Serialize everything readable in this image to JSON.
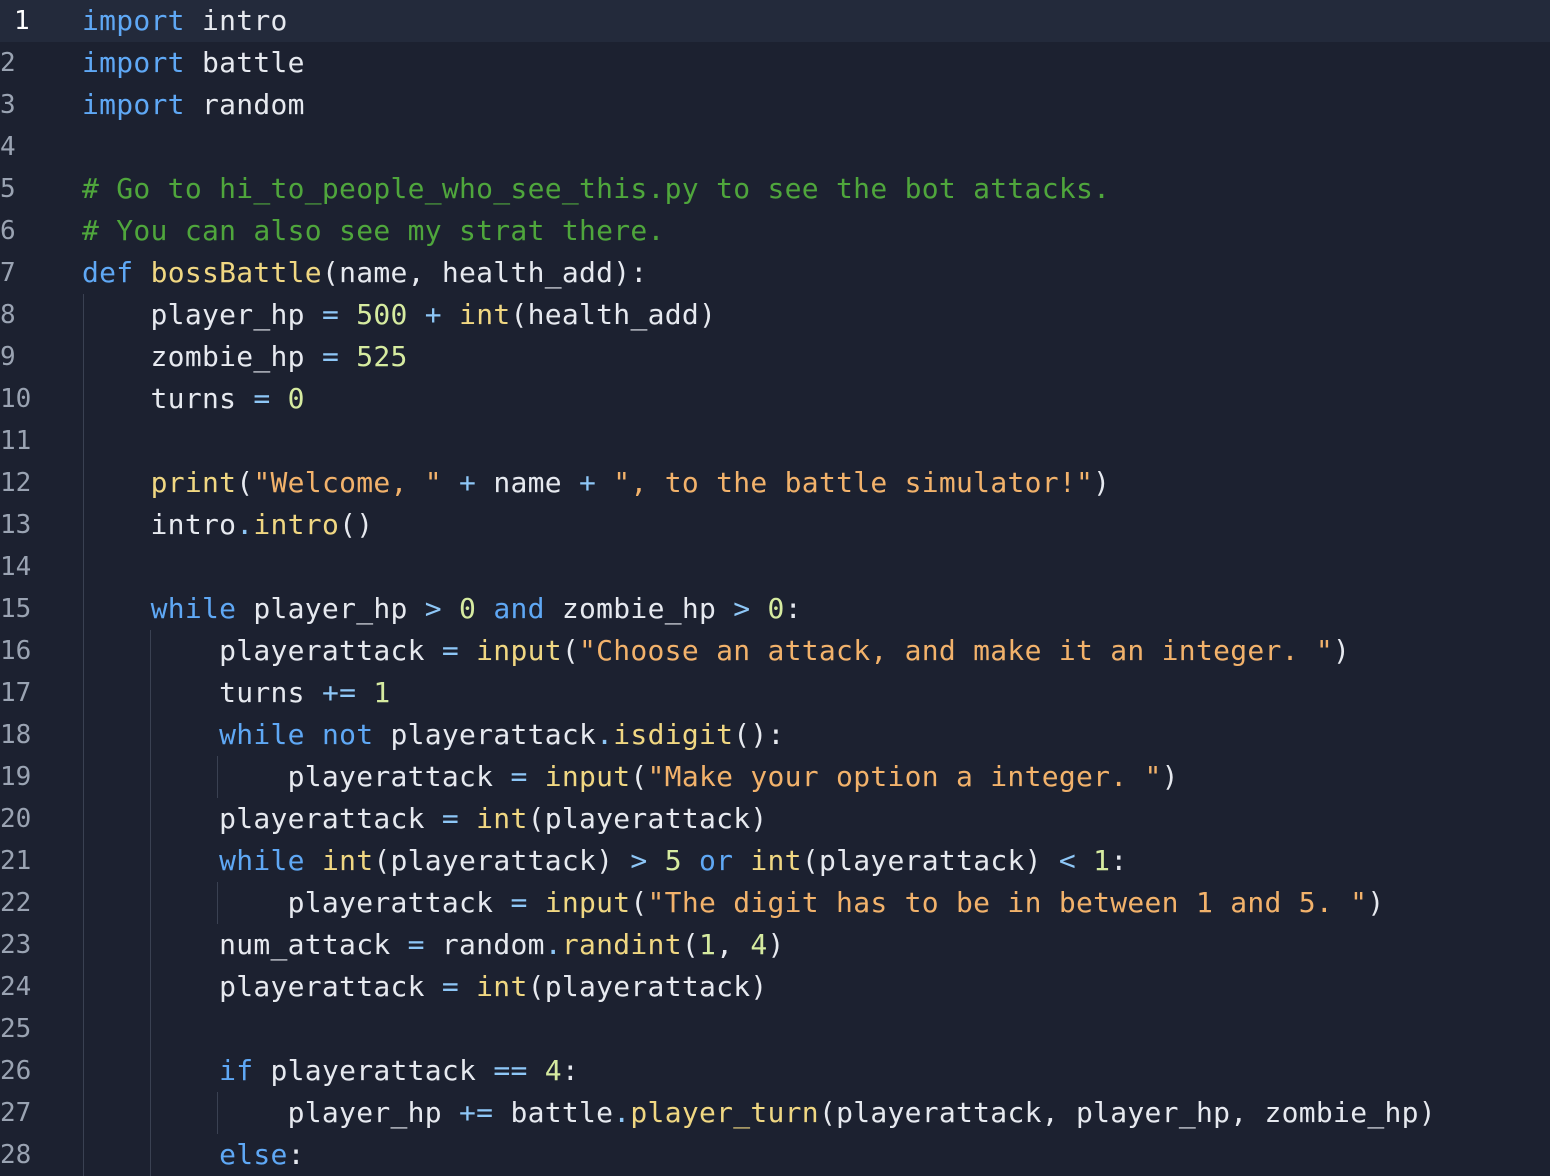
{
  "editor": {
    "active_line": 1,
    "language": "python",
    "lines": [
      {
        "n": "1",
        "tokens": [
          {
            "t": "kw",
            "v": "import"
          },
          {
            "t": "tx",
            "v": " intro"
          }
        ]
      },
      {
        "n": "2",
        "tokens": [
          {
            "t": "kw",
            "v": "import"
          },
          {
            "t": "tx",
            "v": " battle"
          }
        ]
      },
      {
        "n": "3",
        "tokens": [
          {
            "t": "kw",
            "v": "import"
          },
          {
            "t": "tx",
            "v": " random"
          }
        ]
      },
      {
        "n": "4",
        "tokens": []
      },
      {
        "n": "5",
        "tokens": [
          {
            "t": "cm",
            "v": "# Go to hi_to_people_who_see_this.py to see the bot attacks."
          }
        ]
      },
      {
        "n": "6",
        "tokens": [
          {
            "t": "cm",
            "v": "# You can also see my strat there."
          }
        ]
      },
      {
        "n": "7",
        "tokens": [
          {
            "t": "kw",
            "v": "def"
          },
          {
            "t": "tx",
            "v": " "
          },
          {
            "t": "fn",
            "v": "bossBattle"
          },
          {
            "t": "tx",
            "v": "(name, health_add):"
          }
        ]
      },
      {
        "n": "8",
        "tokens": [
          {
            "t": "tx",
            "v": "    player_hp "
          },
          {
            "t": "op",
            "v": "="
          },
          {
            "t": "tx",
            "v": " "
          },
          {
            "t": "nm",
            "v": "500"
          },
          {
            "t": "tx",
            "v": " "
          },
          {
            "t": "op",
            "v": "+"
          },
          {
            "t": "tx",
            "v": " "
          },
          {
            "t": "fn",
            "v": "int"
          },
          {
            "t": "tx",
            "v": "(health_add)"
          }
        ]
      },
      {
        "n": "9",
        "tokens": [
          {
            "t": "tx",
            "v": "    zombie_hp "
          },
          {
            "t": "op",
            "v": "="
          },
          {
            "t": "tx",
            "v": " "
          },
          {
            "t": "nm",
            "v": "525"
          }
        ]
      },
      {
        "n": "10",
        "tokens": [
          {
            "t": "tx",
            "v": "    turns "
          },
          {
            "t": "op",
            "v": "="
          },
          {
            "t": "tx",
            "v": " "
          },
          {
            "t": "nm",
            "v": "0"
          }
        ]
      },
      {
        "n": "11",
        "tokens": []
      },
      {
        "n": "12",
        "tokens": [
          {
            "t": "tx",
            "v": "    "
          },
          {
            "t": "fn",
            "v": "print"
          },
          {
            "t": "tx",
            "v": "("
          },
          {
            "t": "st",
            "v": "\"Welcome, \""
          },
          {
            "t": "tx",
            "v": " "
          },
          {
            "t": "op",
            "v": "+"
          },
          {
            "t": "tx",
            "v": " name "
          },
          {
            "t": "op",
            "v": "+"
          },
          {
            "t": "tx",
            "v": " "
          },
          {
            "t": "st",
            "v": "\", to the battle simulator!\""
          },
          {
            "t": "tx",
            "v": ")"
          }
        ]
      },
      {
        "n": "13",
        "tokens": [
          {
            "t": "tx",
            "v": "    intro"
          },
          {
            "t": "op",
            "v": "."
          },
          {
            "t": "fn",
            "v": "intro"
          },
          {
            "t": "tx",
            "v": "()"
          }
        ]
      },
      {
        "n": "14",
        "tokens": []
      },
      {
        "n": "15",
        "tokens": [
          {
            "t": "tx",
            "v": "    "
          },
          {
            "t": "kw",
            "v": "while"
          },
          {
            "t": "tx",
            "v": " player_hp "
          },
          {
            "t": "op",
            "v": ">"
          },
          {
            "t": "tx",
            "v": " "
          },
          {
            "t": "nm",
            "v": "0"
          },
          {
            "t": "tx",
            "v": " "
          },
          {
            "t": "kw",
            "v": "and"
          },
          {
            "t": "tx",
            "v": " zombie_hp "
          },
          {
            "t": "op",
            "v": ">"
          },
          {
            "t": "tx",
            "v": " "
          },
          {
            "t": "nm",
            "v": "0"
          },
          {
            "t": "tx",
            "v": ":"
          }
        ]
      },
      {
        "n": "16",
        "tokens": [
          {
            "t": "tx",
            "v": "        playerattack "
          },
          {
            "t": "op",
            "v": "="
          },
          {
            "t": "tx",
            "v": " "
          },
          {
            "t": "fn",
            "v": "input"
          },
          {
            "t": "tx",
            "v": "("
          },
          {
            "t": "st",
            "v": "\"Choose an attack, and make it an integer. \""
          },
          {
            "t": "tx",
            "v": ")"
          }
        ]
      },
      {
        "n": "17",
        "tokens": [
          {
            "t": "tx",
            "v": "        turns "
          },
          {
            "t": "op",
            "v": "+="
          },
          {
            "t": "tx",
            "v": " "
          },
          {
            "t": "nm",
            "v": "1"
          }
        ]
      },
      {
        "n": "18",
        "tokens": [
          {
            "t": "tx",
            "v": "        "
          },
          {
            "t": "kw",
            "v": "while"
          },
          {
            "t": "tx",
            "v": " "
          },
          {
            "t": "kw",
            "v": "not"
          },
          {
            "t": "tx",
            "v": " playerattack"
          },
          {
            "t": "op",
            "v": "."
          },
          {
            "t": "fn",
            "v": "isdigit"
          },
          {
            "t": "tx",
            "v": "():"
          }
        ]
      },
      {
        "n": "19",
        "tokens": [
          {
            "t": "tx",
            "v": "            playerattack "
          },
          {
            "t": "op",
            "v": "="
          },
          {
            "t": "tx",
            "v": " "
          },
          {
            "t": "fn",
            "v": "input"
          },
          {
            "t": "tx",
            "v": "("
          },
          {
            "t": "st",
            "v": "\"Make your option a integer. \""
          },
          {
            "t": "tx",
            "v": ")"
          }
        ]
      },
      {
        "n": "20",
        "tokens": [
          {
            "t": "tx",
            "v": "        playerattack "
          },
          {
            "t": "op",
            "v": "="
          },
          {
            "t": "tx",
            "v": " "
          },
          {
            "t": "fn",
            "v": "int"
          },
          {
            "t": "tx",
            "v": "(playerattack)"
          }
        ]
      },
      {
        "n": "21",
        "tokens": [
          {
            "t": "tx",
            "v": "        "
          },
          {
            "t": "kw",
            "v": "while"
          },
          {
            "t": "tx",
            "v": " "
          },
          {
            "t": "fn",
            "v": "int"
          },
          {
            "t": "tx",
            "v": "(playerattack) "
          },
          {
            "t": "op",
            "v": ">"
          },
          {
            "t": "tx",
            "v": " "
          },
          {
            "t": "nm",
            "v": "5"
          },
          {
            "t": "tx",
            "v": " "
          },
          {
            "t": "kw",
            "v": "or"
          },
          {
            "t": "tx",
            "v": " "
          },
          {
            "t": "fn",
            "v": "int"
          },
          {
            "t": "tx",
            "v": "(playerattack) "
          },
          {
            "t": "op",
            "v": "<"
          },
          {
            "t": "tx",
            "v": " "
          },
          {
            "t": "nm",
            "v": "1"
          },
          {
            "t": "tx",
            "v": ":"
          }
        ]
      },
      {
        "n": "22",
        "tokens": [
          {
            "t": "tx",
            "v": "            playerattack "
          },
          {
            "t": "op",
            "v": "="
          },
          {
            "t": "tx",
            "v": " "
          },
          {
            "t": "fn",
            "v": "input"
          },
          {
            "t": "tx",
            "v": "("
          },
          {
            "t": "st",
            "v": "\"The digit has to be in between 1 and 5. \""
          },
          {
            "t": "tx",
            "v": ")"
          }
        ]
      },
      {
        "n": "23",
        "tokens": [
          {
            "t": "tx",
            "v": "        num_attack "
          },
          {
            "t": "op",
            "v": "="
          },
          {
            "t": "tx",
            "v": " random"
          },
          {
            "t": "op",
            "v": "."
          },
          {
            "t": "fn",
            "v": "randint"
          },
          {
            "t": "tx",
            "v": "("
          },
          {
            "t": "nm",
            "v": "1"
          },
          {
            "t": "tx",
            "v": ", "
          },
          {
            "t": "nm",
            "v": "4"
          },
          {
            "t": "tx",
            "v": ")"
          }
        ]
      },
      {
        "n": "24",
        "tokens": [
          {
            "t": "tx",
            "v": "        playerattack "
          },
          {
            "t": "op",
            "v": "="
          },
          {
            "t": "tx",
            "v": " "
          },
          {
            "t": "fn",
            "v": "int"
          },
          {
            "t": "tx",
            "v": "(playerattack)"
          }
        ]
      },
      {
        "n": "25",
        "tokens": []
      },
      {
        "n": "26",
        "tokens": [
          {
            "t": "tx",
            "v": "        "
          },
          {
            "t": "kw",
            "v": "if"
          },
          {
            "t": "tx",
            "v": " playerattack "
          },
          {
            "t": "op",
            "v": "=="
          },
          {
            "t": "tx",
            "v": " "
          },
          {
            "t": "nm",
            "v": "4"
          },
          {
            "t": "tx",
            "v": ":"
          }
        ]
      },
      {
        "n": "27",
        "tokens": [
          {
            "t": "tx",
            "v": "            player_hp "
          },
          {
            "t": "op",
            "v": "+="
          },
          {
            "t": "tx",
            "v": " battle"
          },
          {
            "t": "op",
            "v": "."
          },
          {
            "t": "fn",
            "v": "player_turn"
          },
          {
            "t": "tx",
            "v": "(playerattack, player_hp, zombie_hp)"
          }
        ]
      },
      {
        "n": "28",
        "tokens": [
          {
            "t": "tx",
            "v": "        "
          },
          {
            "t": "kw",
            "v": "else"
          },
          {
            "t": "tx",
            "v": ":"
          }
        ]
      }
    ]
  }
}
